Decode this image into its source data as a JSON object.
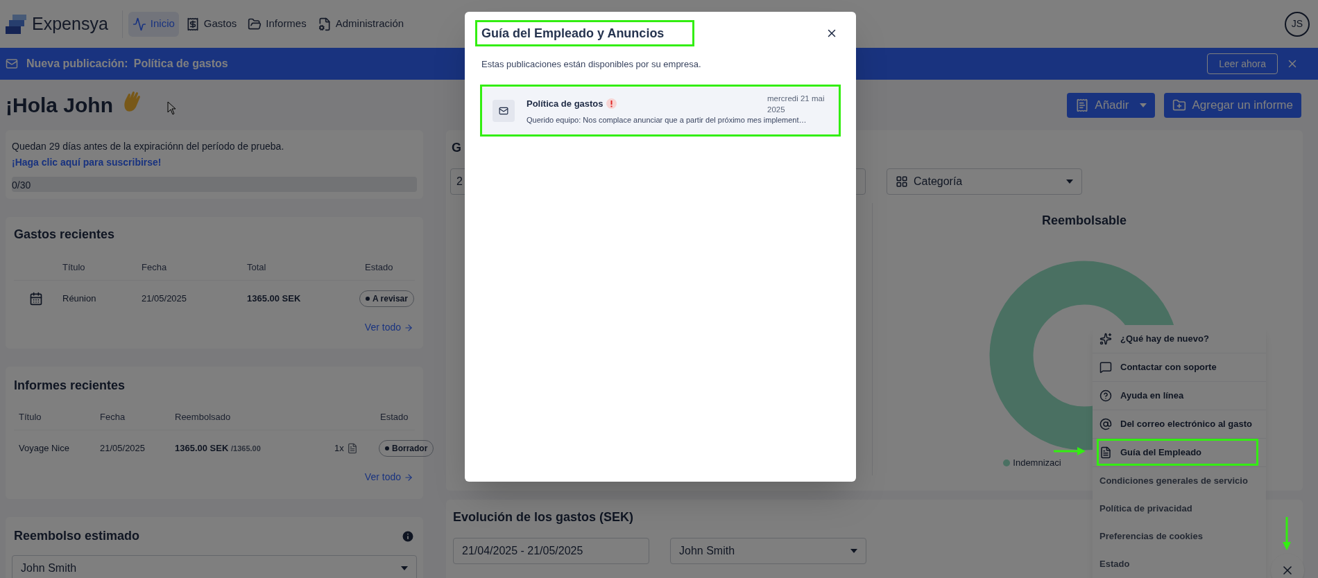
{
  "header": {
    "logo": "Expensya",
    "nav": [
      {
        "label": "Inicio",
        "selected": true
      },
      {
        "label": "Gastos",
        "selected": false
      },
      {
        "label": "Informes",
        "selected": false
      },
      {
        "label": "Administración",
        "selected": false
      }
    ],
    "avatar": "JS"
  },
  "banner": {
    "label": "Nueva publicación:",
    "title": "Política de gastos",
    "button": "Leer ahora"
  },
  "greeting": "¡Hola John",
  "actions": {
    "add": "Añadir",
    "add_report": "Agregar un informe"
  },
  "trial": {
    "message": "Quedan 29 días antes de la expiraciónn del período de prueba.",
    "link": "¡Haga clic aquí para suscribirse!",
    "progress": "0/30",
    "level": 0
  },
  "recent_expenses": {
    "title": "Gastos recientes",
    "columns": [
      "Título",
      "Fecha",
      "Total",
      "Estado"
    ],
    "rows": [
      {
        "title": "Réunion",
        "date": "21/05/2025",
        "total": "1365.00 SEK",
        "status": "A revisar"
      }
    ],
    "link": "Ver todo"
  },
  "recent_reports": {
    "title": "Informes recientes",
    "columns": [
      "Título",
      "Fecha",
      "Reembolsado",
      "Estado"
    ],
    "rows": [
      {
        "title": "Voyage Nice",
        "date": "21/05/2025",
        "reimbursed": "1365.00 SEK",
        "reimbursed_of": "/1365.00",
        "count": "1x",
        "status": "Borrador"
      }
    ],
    "link": "Ver todo"
  },
  "estimated": {
    "title": "Reembolso estimado",
    "user": "John Smith"
  },
  "expenses_card": {
    "title": "G",
    "period": "2",
    "category": "Categoría",
    "chart_title": "Reembolsable",
    "legend": [
      {
        "label": "Indemnizaci"
      }
    ]
  },
  "evolution": {
    "title": "Evolución de los gastos (SEK)",
    "period": "21/04/2025 - 21/05/2025",
    "user": "John Smith"
  },
  "help_menu": {
    "items": [
      {
        "kind": "action",
        "label": "¿Qué hay de nuevo?"
      },
      {
        "kind": "action",
        "label": "Contactar con soporte"
      },
      {
        "kind": "action",
        "label": "Ayuda en línea"
      },
      {
        "kind": "action",
        "label": "Del correo electrónico al gasto"
      },
      {
        "kind": "action",
        "label": "Guía del Empleado"
      },
      {
        "kind": "link",
        "label": "Condiciones generales de servicio"
      },
      {
        "kind": "link",
        "label": "Política de privacidad"
      },
      {
        "kind": "link",
        "label": "Preferencias de cookies"
      },
      {
        "kind": "link",
        "label": "Estado"
      }
    ]
  },
  "modal": {
    "title": "Guía del Empleado y Anuncios",
    "subtitle": "Estas publicaciones están disponibles por su empresa.",
    "posts": [
      {
        "title": "Política de gastos",
        "unread": true,
        "date": "mercredi 21 mai 2025",
        "excerpt": "Querido equipo: Nos complace anunciar que a partir del próximo mes implement…"
      }
    ]
  }
}
